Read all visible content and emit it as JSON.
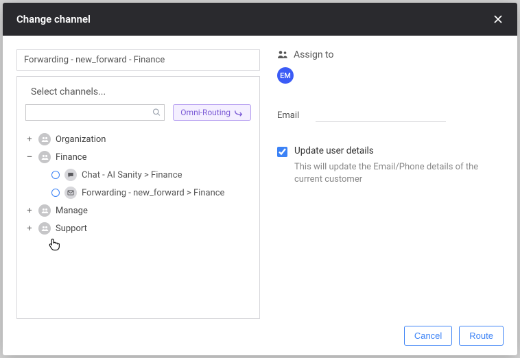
{
  "modal": {
    "title": "Change channel"
  },
  "selected_path": "Forwarding - new_forward - Finance",
  "select_channels": {
    "title": "Select channels...",
    "omni_label": "Omni-Routing"
  },
  "tree": {
    "org_label": "Organization",
    "finance_label": "Finance",
    "manage_label": "Manage",
    "support_label": "Support",
    "chat_channel": "Chat - AI Sanity > Finance",
    "fwd_channel": "Forwarding - new_forward > Finance"
  },
  "assign": {
    "label": "Assign to",
    "avatar_initials": "EM"
  },
  "email": {
    "label": "Email"
  },
  "update_details": {
    "label": "Update user details",
    "desc": "This will update the Email/Phone details of the current customer"
  },
  "footer": {
    "cancel": "Cancel",
    "route": "Route"
  }
}
